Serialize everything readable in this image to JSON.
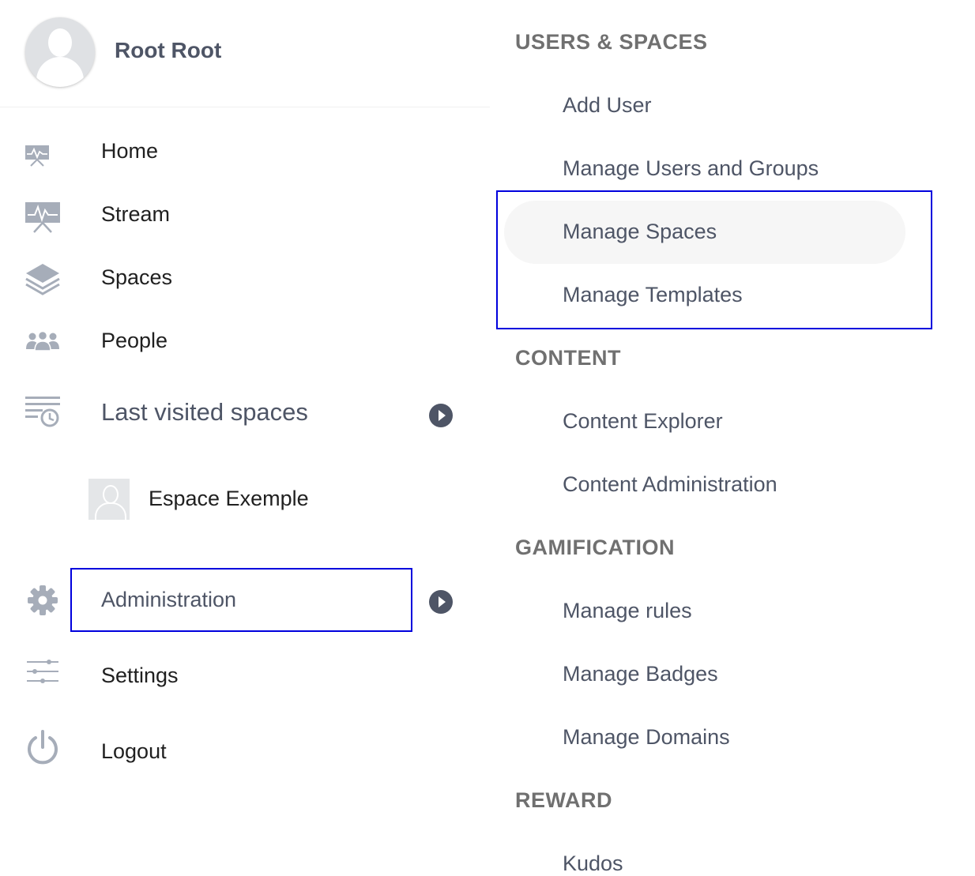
{
  "user": {
    "name": "Root Root"
  },
  "nav": {
    "items": [
      {
        "label": "Home",
        "icon": "home-icon"
      },
      {
        "label": "Stream",
        "icon": "stream-icon"
      },
      {
        "label": "Spaces",
        "icon": "spaces-icon"
      },
      {
        "label": "People",
        "icon": "people-icon"
      },
      {
        "label": "Last visited spaces",
        "icon": "recent-spaces-icon"
      },
      {
        "label": "Administration",
        "icon": "gear-icon"
      },
      {
        "label": "Settings",
        "icon": "sliders-icon"
      },
      {
        "label": "Logout",
        "icon": "power-icon"
      }
    ],
    "recent_spaces": [
      {
        "label": "Espace Exemple"
      }
    ]
  },
  "admin_menu": {
    "sections": [
      {
        "title": "USERS & SPACES",
        "items": [
          "Add User",
          "Manage Users and Groups",
          "Manage Spaces",
          "Manage Templates"
        ]
      },
      {
        "title": "CONTENT",
        "items": [
          "Content Explorer",
          "Content Administration"
        ]
      },
      {
        "title": "GAMIFICATION",
        "items": [
          "Manage rules",
          "Manage Badges",
          "Manage Domains"
        ]
      },
      {
        "title": "REWARD",
        "items": [
          "Kudos"
        ]
      }
    ]
  },
  "colors": {
    "icon": "#a6adb9",
    "label": "#4e5566",
    "section_title": "#707070",
    "highlight": "#0000dd",
    "hover_bg": "#f6f6f6"
  }
}
